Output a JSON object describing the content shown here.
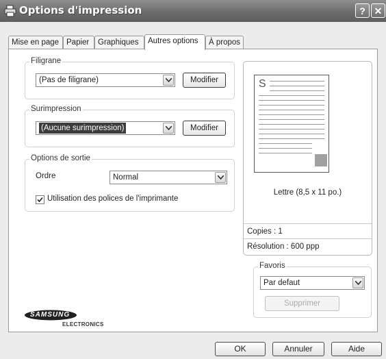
{
  "window": {
    "title": "Options d'impression",
    "help_label": "?",
    "close_label": "✕"
  },
  "tabs": [
    {
      "label": "Mise en page"
    },
    {
      "label": "Papier"
    },
    {
      "label": "Graphiques"
    },
    {
      "label": "Autres options",
      "active": true
    },
    {
      "label": "À propos"
    }
  ],
  "watermark": {
    "group_label": "Filigrane",
    "selected": "(Pas de filigrane)",
    "edit_label": "Modifier"
  },
  "overlay": {
    "group_label": "Surimpression",
    "selected": "(Aucune surimpression)",
    "edit_label": "Modifier"
  },
  "output": {
    "group_label": "Options de sortie",
    "order_label": "Ordre",
    "order_value": "Normal",
    "printer_fonts_label": "Utilisation des polices de l'imprimante",
    "printer_fonts_checked": true
  },
  "preview": {
    "paper_letter": "S",
    "paper_size": "Lettre (8,5 x 11 po.)",
    "copies": "Copies : 1",
    "resolution": "Résolution : 600 ppp"
  },
  "favorites": {
    "group_label": "Favoris",
    "selected": "Par defaut",
    "delete_label": "Supprimer"
  },
  "brand": {
    "name": "SAMSUNG",
    "sub": "ELECTRONICS"
  },
  "footer": {
    "ok_label": "OK",
    "cancel_label": "Annuler",
    "help_label": "Aide"
  },
  "colors": {
    "titlebar": "#6a6a6a",
    "selection": "#3d3d3d",
    "thumbnail": "#a0a0a0"
  },
  "icons": {
    "title": "printer-icon",
    "dropdown": "chevron-down-icon",
    "check": "checkmark-icon"
  }
}
